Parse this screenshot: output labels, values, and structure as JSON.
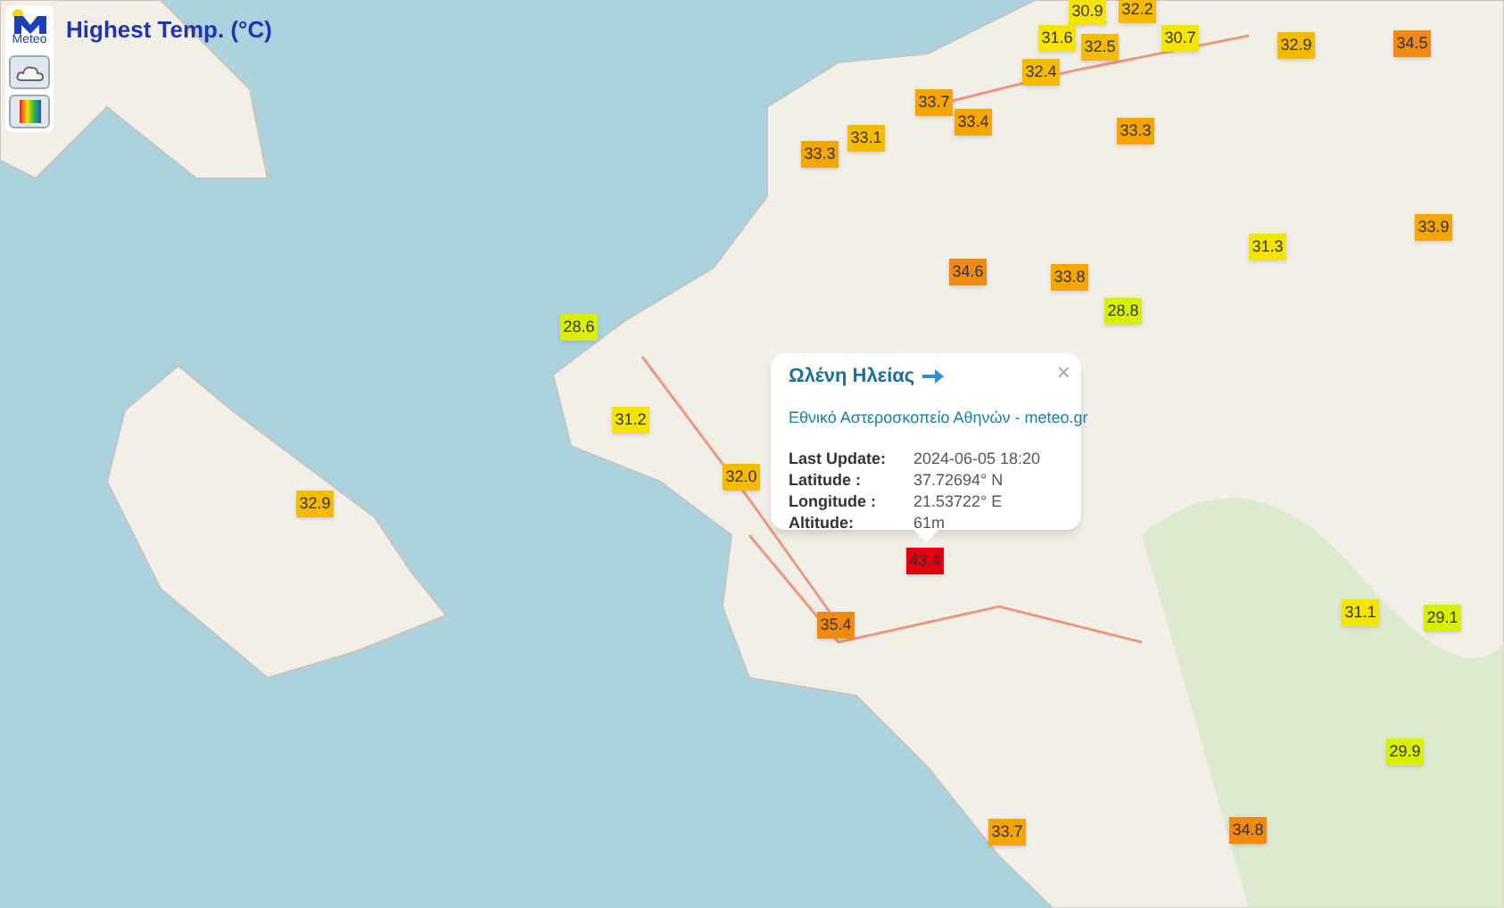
{
  "header": {
    "logo_text": "Meteo",
    "title": "Highest Temp. (°C)"
  },
  "map_controls": [
    {
      "kind": "cloud"
    },
    {
      "kind": "palette"
    }
  ],
  "markers": [
    {
      "value": "30.9",
      "color": "#f5e400"
    },
    {
      "value": "32.2",
      "color": "#f5bb00"
    },
    {
      "value": "31.6",
      "color": "#f5e400"
    },
    {
      "value": "32.5",
      "color": "#f5bb00"
    },
    {
      "value": "30.7",
      "color": "#f5e400"
    },
    {
      "value": "32.4",
      "color": "#f5bb00"
    },
    {
      "value": "32.9",
      "color": "#f5bb00"
    },
    {
      "value": "34.5",
      "color": "#f08a10"
    },
    {
      "value": "33.7",
      "color": "#f5a500"
    },
    {
      "value": "33.4",
      "color": "#f5a500"
    },
    {
      "value": "33.1",
      "color": "#f5bb00"
    },
    {
      "value": "33.3",
      "color": "#f5a500"
    },
    {
      "value": "33.3",
      "color": "#f5a500"
    },
    {
      "value": "33.9",
      "color": "#f5a500"
    },
    {
      "value": "31.3",
      "color": "#f5e400"
    },
    {
      "value": "34.6",
      "color": "#f08a10"
    },
    {
      "value": "33.8",
      "color": "#f5a500"
    },
    {
      "value": "28.8",
      "color": "#d8f000"
    },
    {
      "value": "28.6",
      "color": "#d8f000"
    },
    {
      "value": "31.2",
      "color": "#f5e400"
    },
    {
      "value": "32.0",
      "color": "#f5bb00"
    },
    {
      "value": "43.4",
      "color": "#e00010"
    },
    {
      "value": "35.4",
      "color": "#f08a10"
    },
    {
      "value": "32.9",
      "color": "#f5bb00"
    },
    {
      "value": "31.1",
      "color": "#f5e400"
    },
    {
      "value": "29.1",
      "color": "#d8f000"
    },
    {
      "value": "29.9",
      "color": "#d8f000"
    },
    {
      "value": "33.7",
      "color": "#f5a500"
    },
    {
      "value": "34.8",
      "color": "#f08a10"
    }
  ],
  "popup": {
    "station": "Ωλένη Ηλείας",
    "source_link": "Εθνικό Αστεροσκοπείο Αθηνών - meteo.gr",
    "close": "×",
    "fields": [
      {
        "label": "Last Update:",
        "value": "2024-06-05 18:20"
      },
      {
        "label": "Latitude :",
        "value": "37.72694° N"
      },
      {
        "label": "Longitude :",
        "value": "21.53722° E"
      },
      {
        "label": "Altitude:",
        "value": "61m"
      }
    ]
  }
}
